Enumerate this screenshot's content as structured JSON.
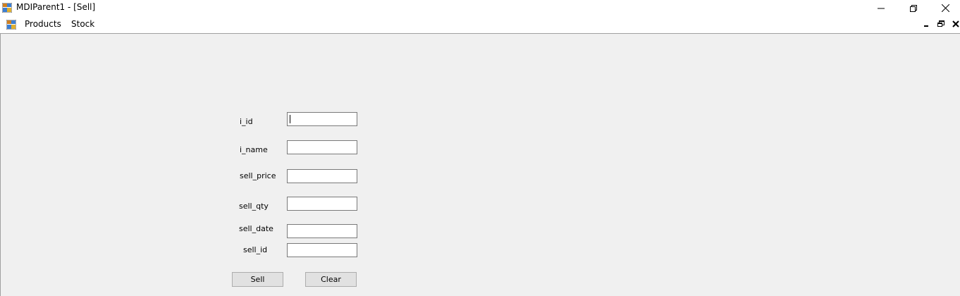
{
  "window": {
    "title": "MDIParent1 - [Sell]",
    "icon": "mdi-app-icon",
    "controls": [
      "minimize-icon",
      "restore-icon",
      "close-icon"
    ]
  },
  "menu": {
    "icon": "mdi-child-icon",
    "items": [
      {
        "label": "Products"
      },
      {
        "label": "Stock"
      }
    ],
    "mdi_controls": [
      "child-minimize-icon",
      "child-restore-icon",
      "child-close-icon"
    ]
  },
  "form": {
    "fields": [
      {
        "label": "i_id",
        "value": ""
      },
      {
        "label": "i_name",
        "value": ""
      },
      {
        "label": "sell_price",
        "value": ""
      },
      {
        "label": "sell_qty",
        "value": ""
      },
      {
        "label": "sell_date",
        "value": ""
      },
      {
        "label": "sell_id",
        "value": ""
      }
    ],
    "buttons": {
      "sell": "Sell",
      "clear": "Clear"
    }
  },
  "colors": {
    "client_bg": "#f0f0f0",
    "titlebar_bg": "#ffffff",
    "button_bg": "#e1e1e1"
  }
}
